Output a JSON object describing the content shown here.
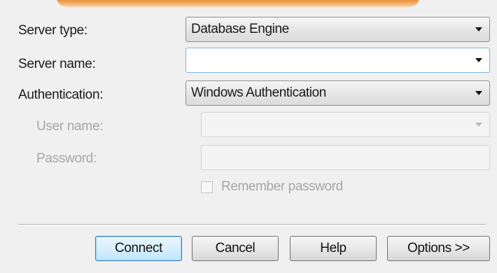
{
  "form": {
    "server_type_label": "Server type:",
    "server_type_value": "Database Engine",
    "server_name_label": "Server name:",
    "server_name_value": "",
    "authentication_label": "Authentication:",
    "authentication_value": "Windows Authentication",
    "user_name_label": "User name:",
    "user_name_value": "",
    "password_label": "Password:",
    "password_value": "",
    "remember_password_label": "Remember password",
    "remember_password_checked": false
  },
  "buttons": {
    "connect": "Connect",
    "cancel": "Cancel",
    "help": "Help",
    "options": "Options >>"
  },
  "colors": {
    "window_background": "#f0f0f0",
    "banner_accent": "#e0781c",
    "default_button_border": "#3c7fb1",
    "disabled_text": "#a6a6a6"
  },
  "icons": {
    "dropdown": "chevron-down-icon",
    "checkbox": "checkbox-icon"
  }
}
